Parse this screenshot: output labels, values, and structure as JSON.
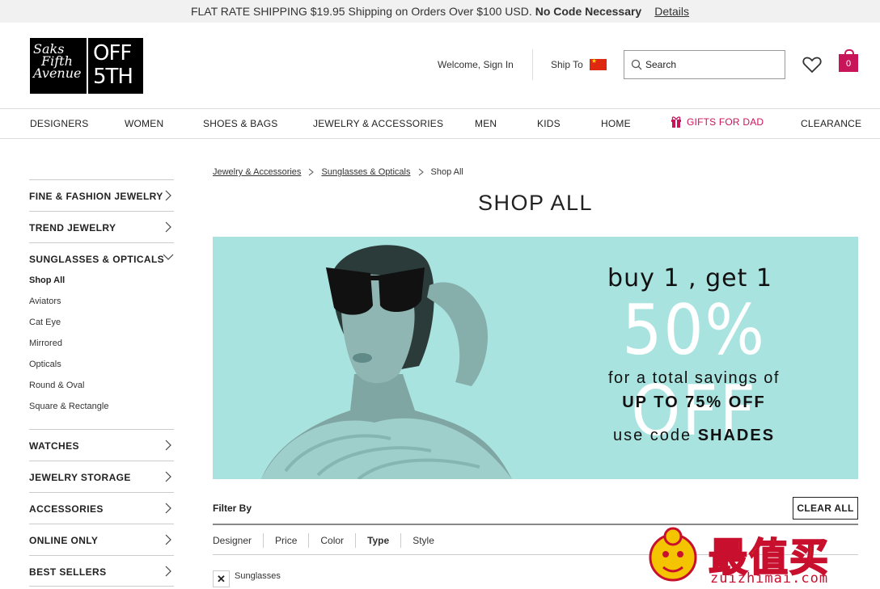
{
  "promo": {
    "text": "FLAT RATE SHIPPING $19.95 Shipping on Orders Over $100 USD.",
    "bold": "No Code Necessary",
    "details": "Details"
  },
  "header": {
    "logo_left": [
      "Saks",
      "Fifth",
      "Avenue"
    ],
    "logo_right": [
      "OFF",
      "5TH"
    ],
    "welcome": "Welcome, Sign In",
    "ship_to": "Ship To",
    "search_placeholder": "Search",
    "bag_count": "0",
    "brand_color": "#c8155a"
  },
  "nav": {
    "items": [
      "DESIGNERS",
      "WOMEN",
      "SHOES & BAGS",
      "JEWELRY & ACCESSORIES",
      "MEN",
      "KIDS",
      "HOME",
      "GIFTS FOR DAD",
      "CLEARANCE"
    ]
  },
  "sidebar": {
    "sections_top": [
      "FINE & FASHION JEWELRY",
      "TREND JEWELRY"
    ],
    "open_section": {
      "label": "SUNGLASSES & OPTICALS",
      "items": [
        "Shop All",
        "Aviators",
        "Cat Eye",
        "Mirrored",
        "Opticals",
        "Round & Oval",
        "Square & Rectangle"
      ],
      "active": "Shop All"
    },
    "sections_bottom": [
      "WATCHES",
      "JEWELRY STORAGE",
      "ACCESSORIES",
      "ONLINE ONLY",
      "BEST SELLERS"
    ]
  },
  "breadcrumb": {
    "items": [
      "Jewelry & Accessories",
      "Sunglasses & Opticals",
      "Shop All"
    ]
  },
  "main": {
    "title": "SHOP ALL"
  },
  "banner": {
    "line1": "buy 1 , get 1",
    "line2": "50% OFF",
    "line3": "for a total savings of",
    "line4": "UP TO 75% OFF",
    "line5_prefix": "use code",
    "line5_code": "SHADES",
    "bg_color": "#a9e3e0"
  },
  "filters": {
    "label": "Filter By",
    "clear_all": "CLEAR ALL",
    "tabs": [
      "Designer",
      "Price",
      "Color",
      "Type",
      "Style"
    ],
    "active_tab": "Type",
    "applied": [
      "Sunglasses"
    ]
  },
  "watermark": {
    "chinese": "最值买",
    "site": "zuizhimai.com"
  }
}
